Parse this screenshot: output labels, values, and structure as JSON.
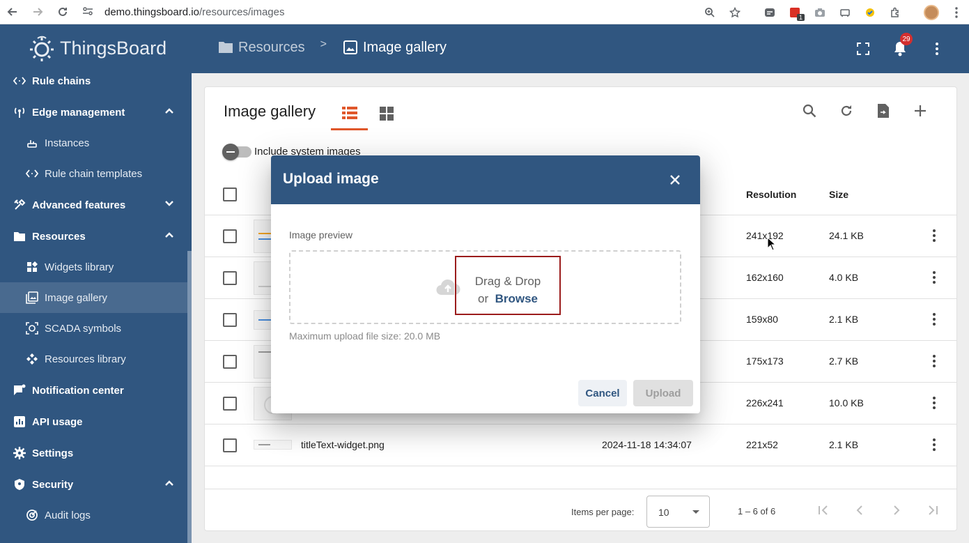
{
  "browser": {
    "url_host": "demo.thingsboard.io",
    "url_path": "/resources/images",
    "extension_badge": "1"
  },
  "header": {
    "logo_text": "ThingsBoard",
    "breadcrumb": [
      {
        "label": "Resources"
      },
      {
        "label": "Image gallery"
      }
    ],
    "breadcrumb_separator": ">",
    "notification_count": "29"
  },
  "sidebar": {
    "items": [
      {
        "label": "Rule chains"
      },
      {
        "label": "Edge management"
      },
      {
        "label": "Instances"
      },
      {
        "label": "Rule chain templates"
      },
      {
        "label": "Advanced features"
      },
      {
        "label": "Resources"
      },
      {
        "label": "Widgets library"
      },
      {
        "label": "Image gallery"
      },
      {
        "label": "SCADA symbols"
      },
      {
        "label": "Resources library"
      },
      {
        "label": "Notification center"
      },
      {
        "label": "API usage"
      },
      {
        "label": "Settings"
      },
      {
        "label": "Security"
      },
      {
        "label": "Audit logs"
      }
    ]
  },
  "gallery": {
    "title": "Image gallery",
    "include_system_label": "Include system images",
    "columns": {
      "resolution": "Resolution",
      "size": "Size"
    },
    "rows": [
      {
        "name": "",
        "date": "",
        "resolution": "241x192",
        "size": "24.1 KB"
      },
      {
        "name": "",
        "date": "",
        "resolution": "162x160",
        "size": "4.0 KB"
      },
      {
        "name": "",
        "date": "",
        "resolution": "159x80",
        "size": "2.1 KB"
      },
      {
        "name": "",
        "date": "",
        "resolution": "175x173",
        "size": "2.7 KB"
      },
      {
        "name": "",
        "date": "",
        "resolution": "226x241",
        "size": "10.0 KB"
      },
      {
        "name": "titleText-widget.png",
        "date": "2024-11-18 14:34:07",
        "resolution": "221x52",
        "size": "2.1 KB"
      }
    ],
    "paginator": {
      "items_per_page_label": "Items per page:",
      "items_per_page": "10",
      "range": "1 – 6 of 6"
    }
  },
  "dialog": {
    "title": "Upload image",
    "preview_label": "Image preview",
    "drag_drop": "Drag & Drop",
    "or": "or",
    "browse": "Browse",
    "max_size": "Maximum upload file size: 20.0 MB",
    "cancel": "Cancel",
    "upload": "Upload"
  },
  "colors": {
    "primary": "#305680",
    "accent": "#e0572b",
    "highlight_box": "#9b1c1c",
    "notification": "#d32f2f"
  }
}
